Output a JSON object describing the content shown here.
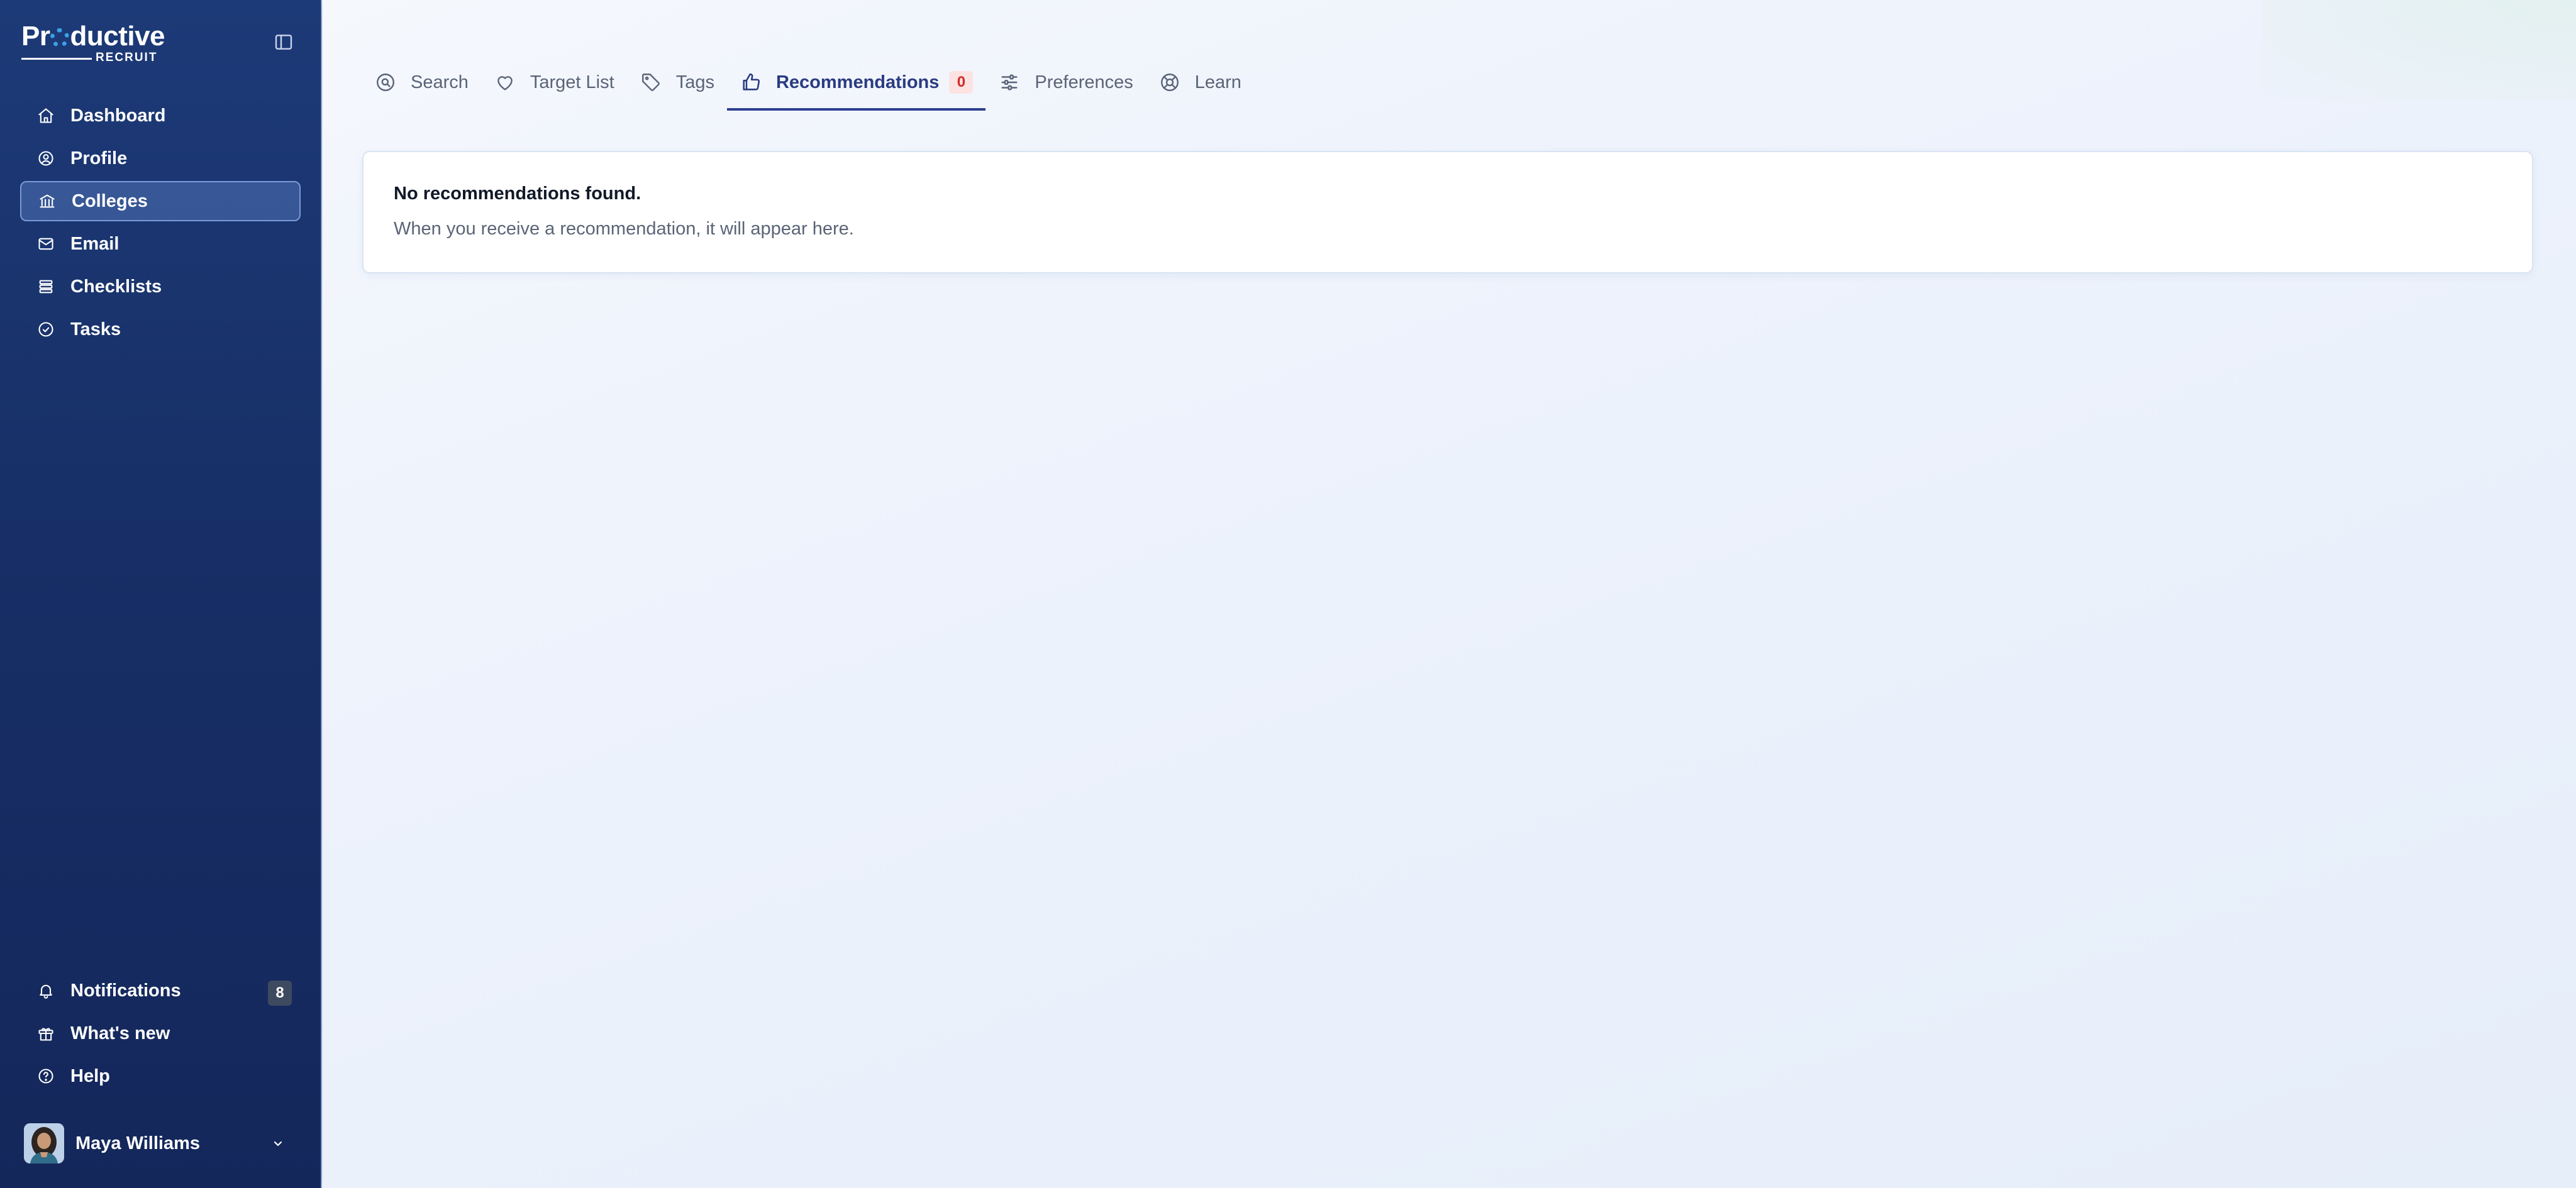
{
  "brand": {
    "name_pre": "Pr",
    "name_post": "ductive",
    "sub": "RECRUIT"
  },
  "sidebar": {
    "items": [
      {
        "label": "Dashboard",
        "icon": "home-icon",
        "active": false
      },
      {
        "label": "Profile",
        "icon": "user-circle-icon",
        "active": false
      },
      {
        "label": "Colleges",
        "icon": "bank-icon",
        "active": true
      },
      {
        "label": "Email",
        "icon": "mail-icon",
        "active": false
      },
      {
        "label": "Checklists",
        "icon": "list-icon",
        "active": false
      },
      {
        "label": "Tasks",
        "icon": "check-circle-icon",
        "active": false
      }
    ],
    "bottom": [
      {
        "label": "Notifications",
        "icon": "bell-icon",
        "badge": "8"
      },
      {
        "label": "What's new",
        "icon": "gift-icon"
      },
      {
        "label": "Help",
        "icon": "help-circle-icon"
      }
    ],
    "user": {
      "name": "Maya Williams"
    }
  },
  "tabs": [
    {
      "label": "Search",
      "icon": "search-icon",
      "active": false
    },
    {
      "label": "Target List",
      "icon": "heart-icon",
      "active": false
    },
    {
      "label": "Tags",
      "icon": "tag-icon",
      "active": false
    },
    {
      "label": "Recommendations",
      "icon": "thumbs-up-icon",
      "active": true,
      "badge": "0"
    },
    {
      "label": "Preferences",
      "icon": "sliders-icon",
      "active": false
    },
    {
      "label": "Learn",
      "icon": "lifebuoy-icon",
      "active": false
    }
  ],
  "empty_state": {
    "title": "No recommendations found.",
    "text": "When you receive a recommendation, it will appear here."
  },
  "colors": {
    "sidebar_bg": "#172f66",
    "accent": "#2e3f93",
    "badge_red": "#d12b2b"
  }
}
